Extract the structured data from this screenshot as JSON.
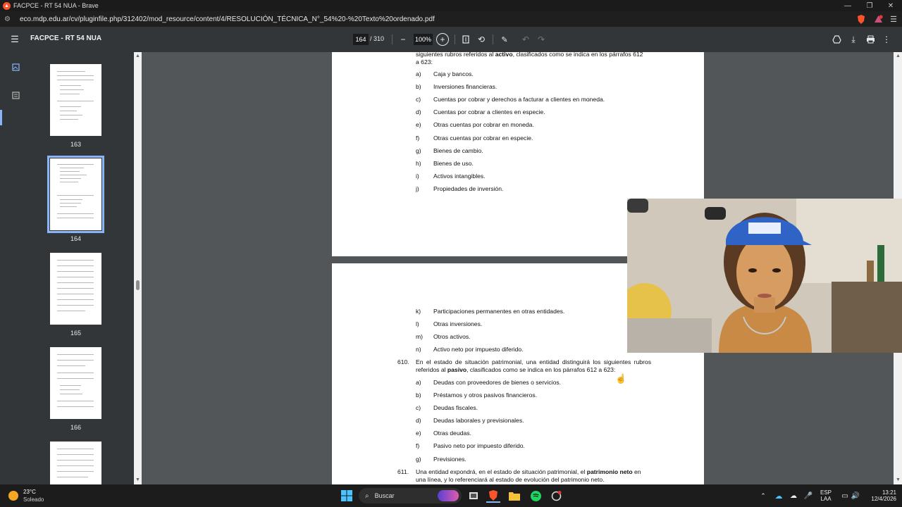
{
  "window": {
    "title": "FACPCE - RT 54 NUA - Brave",
    "minimize": "—",
    "maximize": "❐",
    "close": "✕"
  },
  "address": {
    "url": "eco.mdp.edu.ar/cv/pluginfile.php/312402/mod_resource/content/4/RESOLUCIÓN_TÉCNICA_N°_54%20-%20Texto%20ordenado.pdf"
  },
  "pdf_toolbar": {
    "menu_icon": "menu-icon",
    "doc_title": "FACPCE - RT 54 NUA",
    "current_page": "164",
    "total_pages": "/ 310",
    "zoom": "100%"
  },
  "thumbnails": [
    {
      "label": "163"
    },
    {
      "label": "164"
    },
    {
      "label": "165"
    },
    {
      "label": "166"
    },
    {
      "label": ""
    }
  ],
  "page1": {
    "intro_line1_a": "siguientes rubros referidos al ",
    "intro_line1_b": "activo",
    "intro_line1_c": ", clasificados como se indica en los párrafos 612",
    "intro_line2": "a 623:",
    "items": [
      {
        "letter": "a)",
        "text": "Caja y bancos."
      },
      {
        "letter": "b)",
        "text": "Inversiones financieras."
      },
      {
        "letter": "c)",
        "text": "Cuentas por cobrar y derechos a facturar a clientes en moneda."
      },
      {
        "letter": "d)",
        "text": "Cuentas por cobrar a clientes en especie."
      },
      {
        "letter": "e)",
        "text": "Otras cuentas por cobrar en moneda."
      },
      {
        "letter": "f)",
        "text": "Otras cuentas por cobrar en especie."
      },
      {
        "letter": "g)",
        "text": "Bienes de cambio."
      },
      {
        "letter": "h)",
        "text": "Bienes de uso."
      },
      {
        "letter": "i)",
        "text": "Activos intangibles."
      },
      {
        "letter": "j)",
        "text": "Propiedades de inversión."
      }
    ]
  },
  "page2": {
    "items_top": [
      {
        "letter": "k)",
        "text": "Participaciones permanentes en otras entidades."
      },
      {
        "letter": "l)",
        "text": "Otras inversiones."
      },
      {
        "letter": "m)",
        "text": "Otros activos."
      },
      {
        "letter": "n)",
        "text": "Activo neto por impuesto diferido."
      }
    ],
    "p610_num": "610.",
    "p610_line1": "En el estado de situación patrimonial, una entidad distinguirá los siguientes rubros",
    "p610_line2_a": "referidos al ",
    "p610_line2_b": "pasivo",
    "p610_line2_c": ", clasificados como se indica en los párrafos 612 a 623:",
    "items_bottom": [
      {
        "letter": "a)",
        "text": "Deudas con proveedores de bienes o servicios."
      },
      {
        "letter": "b)",
        "text": "Préstamos y otros pasivos financieros."
      },
      {
        "letter": "c)",
        "text": "Deudas fiscales."
      },
      {
        "letter": "d)",
        "text": "Deudas laborales y previsionales."
      },
      {
        "letter": "e)",
        "text": "Otras deudas."
      },
      {
        "letter": "f)",
        "text": "Pasivo neto por impuesto diferido."
      },
      {
        "letter": "g)",
        "text": "Previsiones."
      }
    ],
    "p611_num": "611.",
    "p611_line1_a": "Una entidad expondrá, en el estado de situación patrimonial, el ",
    "p611_line1_b": "patrimonio neto",
    "p611_line1_c": " en",
    "p611_line2": "una línea, y lo referenciará al estado de evolución del patrimonio neto."
  },
  "taskbar": {
    "weather_temp": "23°C",
    "weather_desc": "Soleado",
    "search_placeholder": "Buscar",
    "lang_1": "ESP",
    "lang_2": "LAA",
    "time": "13:21",
    "date": "12/4/2026"
  },
  "colors": {
    "brave_orange": "#fb542b",
    "accent_blue": "#8ab4f8"
  }
}
